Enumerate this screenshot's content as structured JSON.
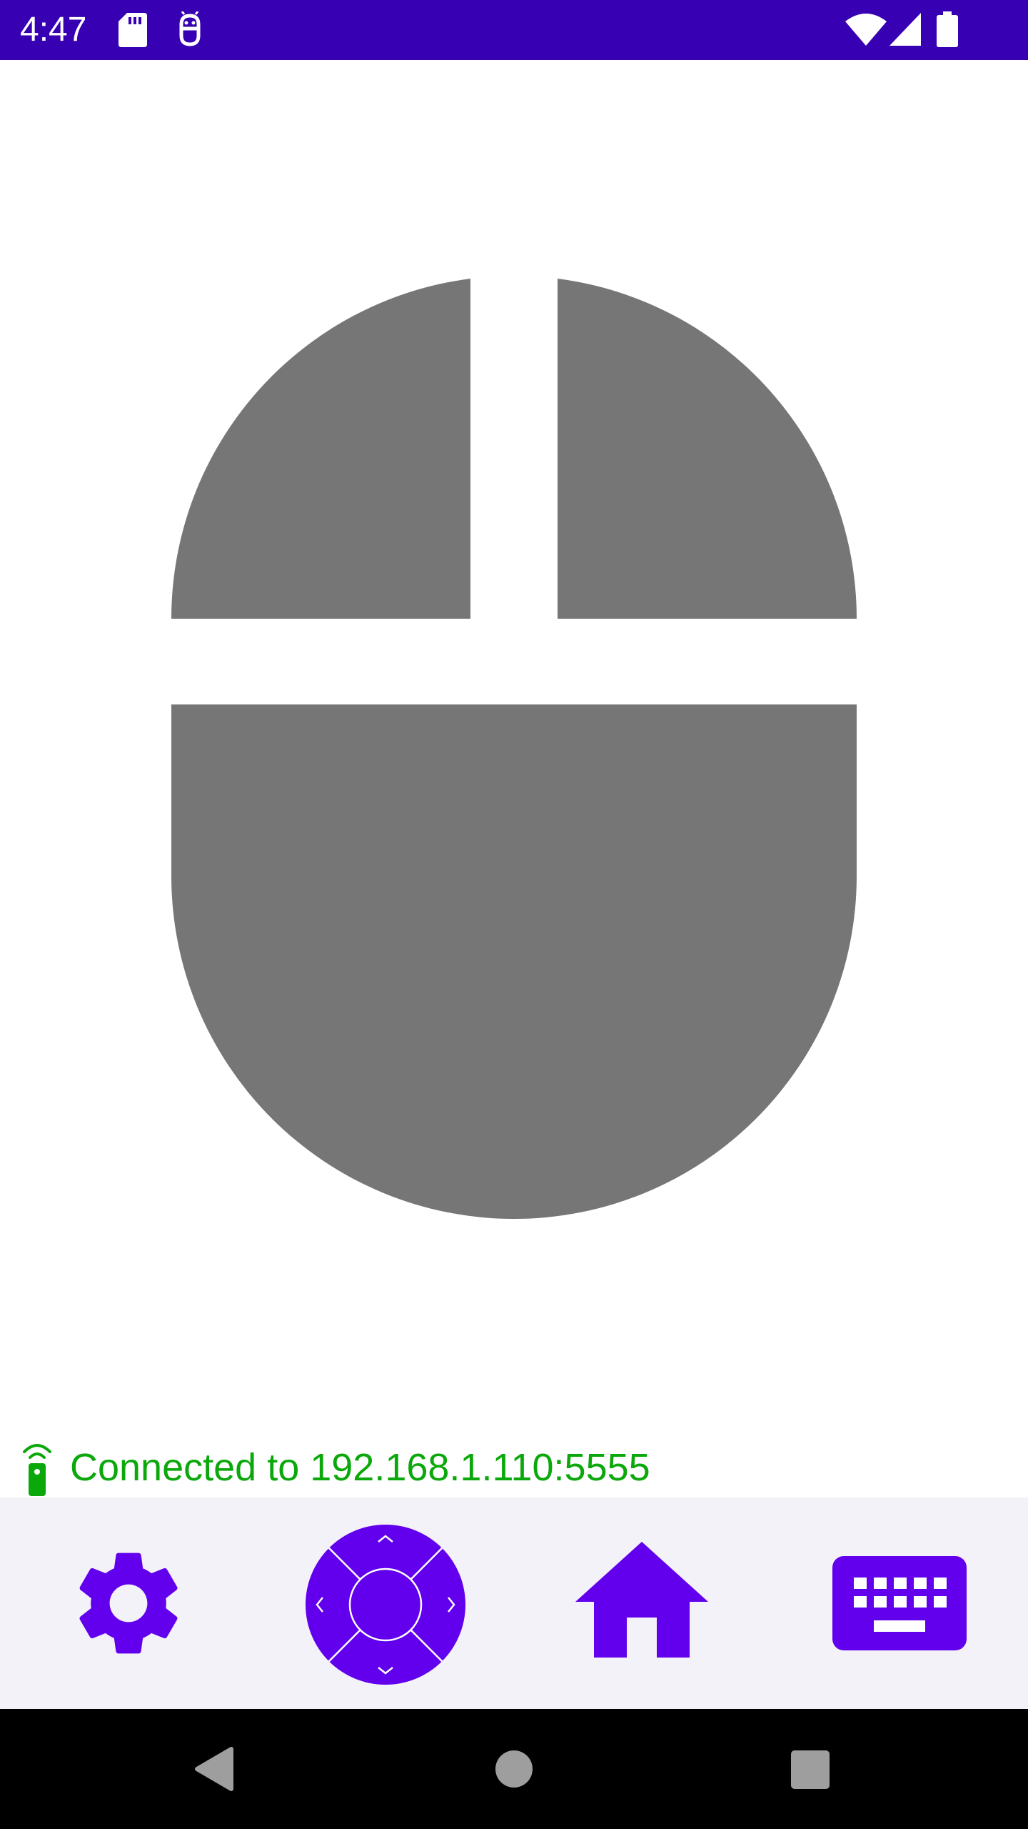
{
  "status_bar": {
    "time": "4:47",
    "left_icons": [
      "sd-card-icon",
      "android-debug-icon"
    ],
    "right_icons": [
      "wifi-icon",
      "cellular-signal-icon",
      "battery-icon"
    ]
  },
  "mouse": {
    "buttons": [
      "left-mouse-button",
      "right-mouse-button",
      "touchpad-area"
    ]
  },
  "connection": {
    "icon": "remote-connection-icon",
    "text": "Connected to 192.168.1.110:5555"
  },
  "toolbar": {
    "items": [
      "gear-icon",
      "dpad-icon",
      "home-icon",
      "keyboard-icon"
    ]
  },
  "nav_bar": {
    "items": [
      "back-icon",
      "home-circle-icon",
      "recents-icon"
    ]
  },
  "colors": {
    "status_bar": "#3700B3",
    "accent": "#6200EE",
    "mouse_gray": "#767676",
    "connection_green": "#0BA80B",
    "toolbar_bg": "#F3F2F8"
  }
}
